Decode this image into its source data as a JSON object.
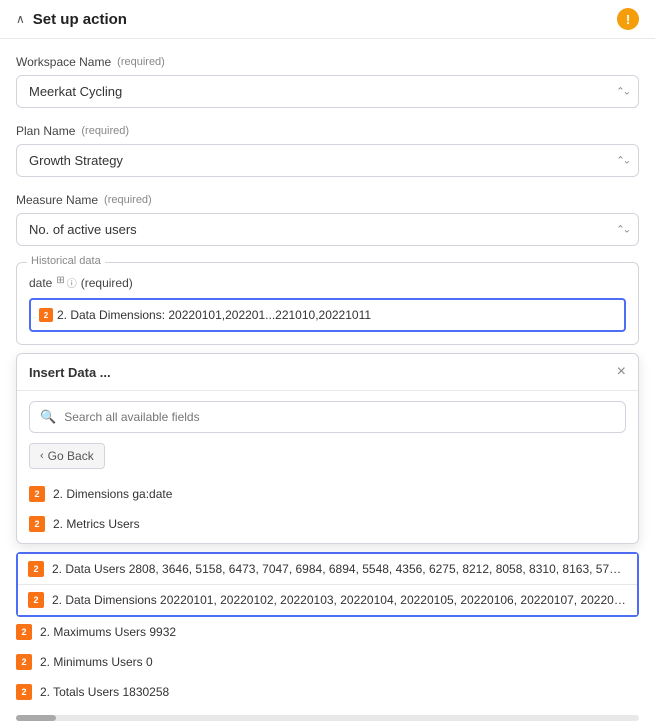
{
  "header": {
    "title": "Set up action",
    "chevron": "∧",
    "warning_icon": "!"
  },
  "workspace": {
    "label": "Workspace Name",
    "required": "(required)",
    "value": "Meerkat Cycling"
  },
  "plan": {
    "label": "Plan Name",
    "required": "(required)",
    "value": "Growth Strategy"
  },
  "measure": {
    "label": "Measure Name",
    "required": "(required)",
    "value": "No. of active users"
  },
  "historical": {
    "section_label": "Historical data",
    "date_label": "date",
    "required": "(required)",
    "token_text": "2. Data Dimensions: 20220101,202201...221010,20221011"
  },
  "insert_data": {
    "title": "Insert Data ...",
    "close": "×",
    "search_placeholder": "Search all available fields",
    "go_back": "Go Back",
    "items": [
      {
        "icon": "2",
        "text": "2. Dimensions  ga:date"
      },
      {
        "icon": "2",
        "text": "2. Metrics  Users"
      }
    ]
  },
  "highlighted_results": [
    {
      "icon": "2",
      "text": "2. Data Users  2808, 3646, 5158, 6473, 7047, 6984, 6894, 5548, 4356, 6275, 8212, 8058, 8310, 8163, 574…"
    },
    {
      "icon": "2",
      "text": "2. Data Dimensions  20220101, 20220102, 20220103, 20220104, 20220105, 20220106, 20220107, 202201…"
    }
  ],
  "extra_items": [
    {
      "icon": "2",
      "text": "2. Maximums Users  9932"
    },
    {
      "icon": "2",
      "text": "2. Minimums Users  0"
    },
    {
      "icon": "2",
      "text": "2. Totals Users  1830258"
    }
  ],
  "colors": {
    "accent": "#4f6ef7",
    "orange": "#f97316",
    "warning": "#f59e0b"
  }
}
